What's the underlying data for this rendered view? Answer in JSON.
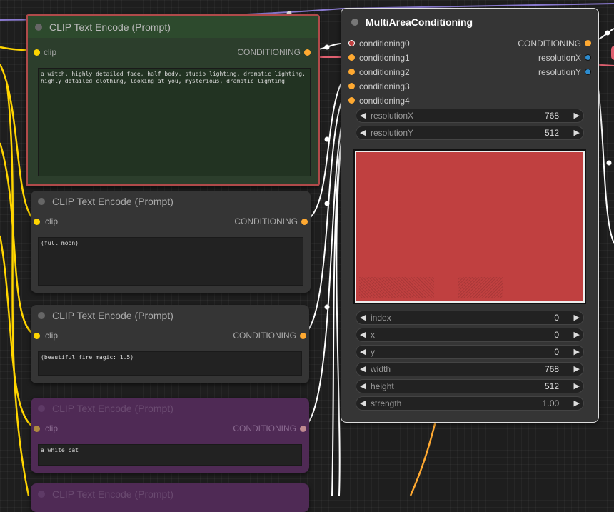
{
  "colors": {
    "conditioning_port": "#ffa931",
    "clip_port": "#ffd500",
    "int_port": "#2d8ccf",
    "selected_border": "#b04a4a",
    "purple_node": "#4f2a55",
    "area_canvas": "#c04040"
  },
  "nodes": [
    {
      "title": "CLIP Text Encode (Prompt)",
      "input": "clip",
      "output": "CONDITIONING",
      "text": "a witch, highly detailed face, half body, studio lighting, dramatic lighting, highly detailed clothing, looking at you, mysterious, dramatic lighting"
    },
    {
      "title": "CLIP Text Encode (Prompt)",
      "input": "clip",
      "output": "CONDITIONING",
      "text": "(full moon)"
    },
    {
      "title": "CLIP Text Encode (Prompt)",
      "input": "clip",
      "output": "CONDITIONING",
      "text": "(beautiful fire magic: 1.5)"
    },
    {
      "title": "CLIP Text Encode (Prompt)",
      "input": "clip",
      "output": "CONDITIONING",
      "text": "a white cat"
    },
    {
      "title": "CLIP Text Encode (Prompt)"
    }
  ],
  "multi_area": {
    "title": "MultiAreaConditioning",
    "inputs": [
      "conditioning0",
      "conditioning1",
      "conditioning2",
      "conditioning3",
      "conditioning4"
    ],
    "outputs": [
      "CONDITIONING",
      "resolutionX",
      "resolutionY"
    ],
    "widgets_top": [
      {
        "label": "resolutionX",
        "value": "768"
      },
      {
        "label": "resolutionY",
        "value": "512"
      }
    ],
    "widgets_bottom": [
      {
        "label": "index",
        "value": "0"
      },
      {
        "label": "x",
        "value": "0"
      },
      {
        "label": "y",
        "value": "0"
      },
      {
        "label": "width",
        "value": "768"
      },
      {
        "label": "height",
        "value": "512"
      },
      {
        "label": "strength",
        "value": "1.00"
      }
    ]
  }
}
